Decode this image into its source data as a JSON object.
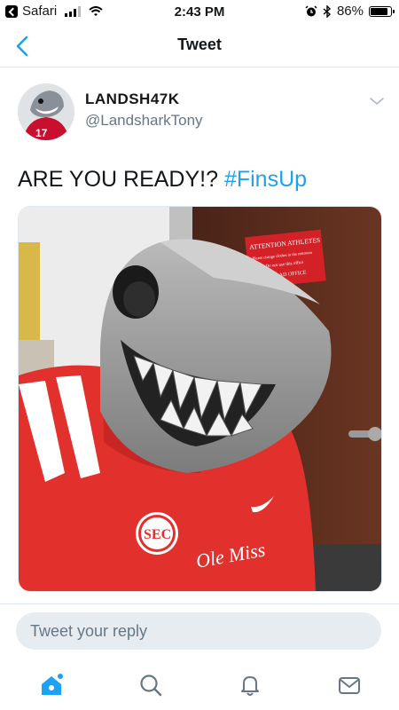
{
  "status_bar": {
    "back_app": "Safari",
    "time": "2:43 PM",
    "battery": "86%",
    "battery_level": 0.86,
    "icons": [
      "signal-icon",
      "wifi-icon",
      "alarm-icon",
      "bluetooth-icon",
      "battery-icon"
    ]
  },
  "nav": {
    "title": "Tweet",
    "back_icon": "chevron-left-icon"
  },
  "tweet": {
    "display_name": "LANDSH47K",
    "handle": "@LandsharkTony",
    "text": "ARE YOU READY!? ",
    "hashtag": "#FinsUp",
    "media": {
      "sign_line1": "ATTENTION ATHLETES",
      "sign_line2": "Please change clothes in the restroom",
      "sign_line3": "Do not use this office",
      "sign_line4": "AD OFFICE",
      "patch_text": "SEC",
      "jersey_text": "Ole Miss"
    }
  },
  "reply": {
    "placeholder": "Tweet your reply"
  },
  "tab_bar": {
    "items": [
      "home-icon",
      "search-icon",
      "notifications-icon",
      "messages-icon"
    ],
    "accent": "#1da1f2",
    "inactive": "#657786"
  }
}
